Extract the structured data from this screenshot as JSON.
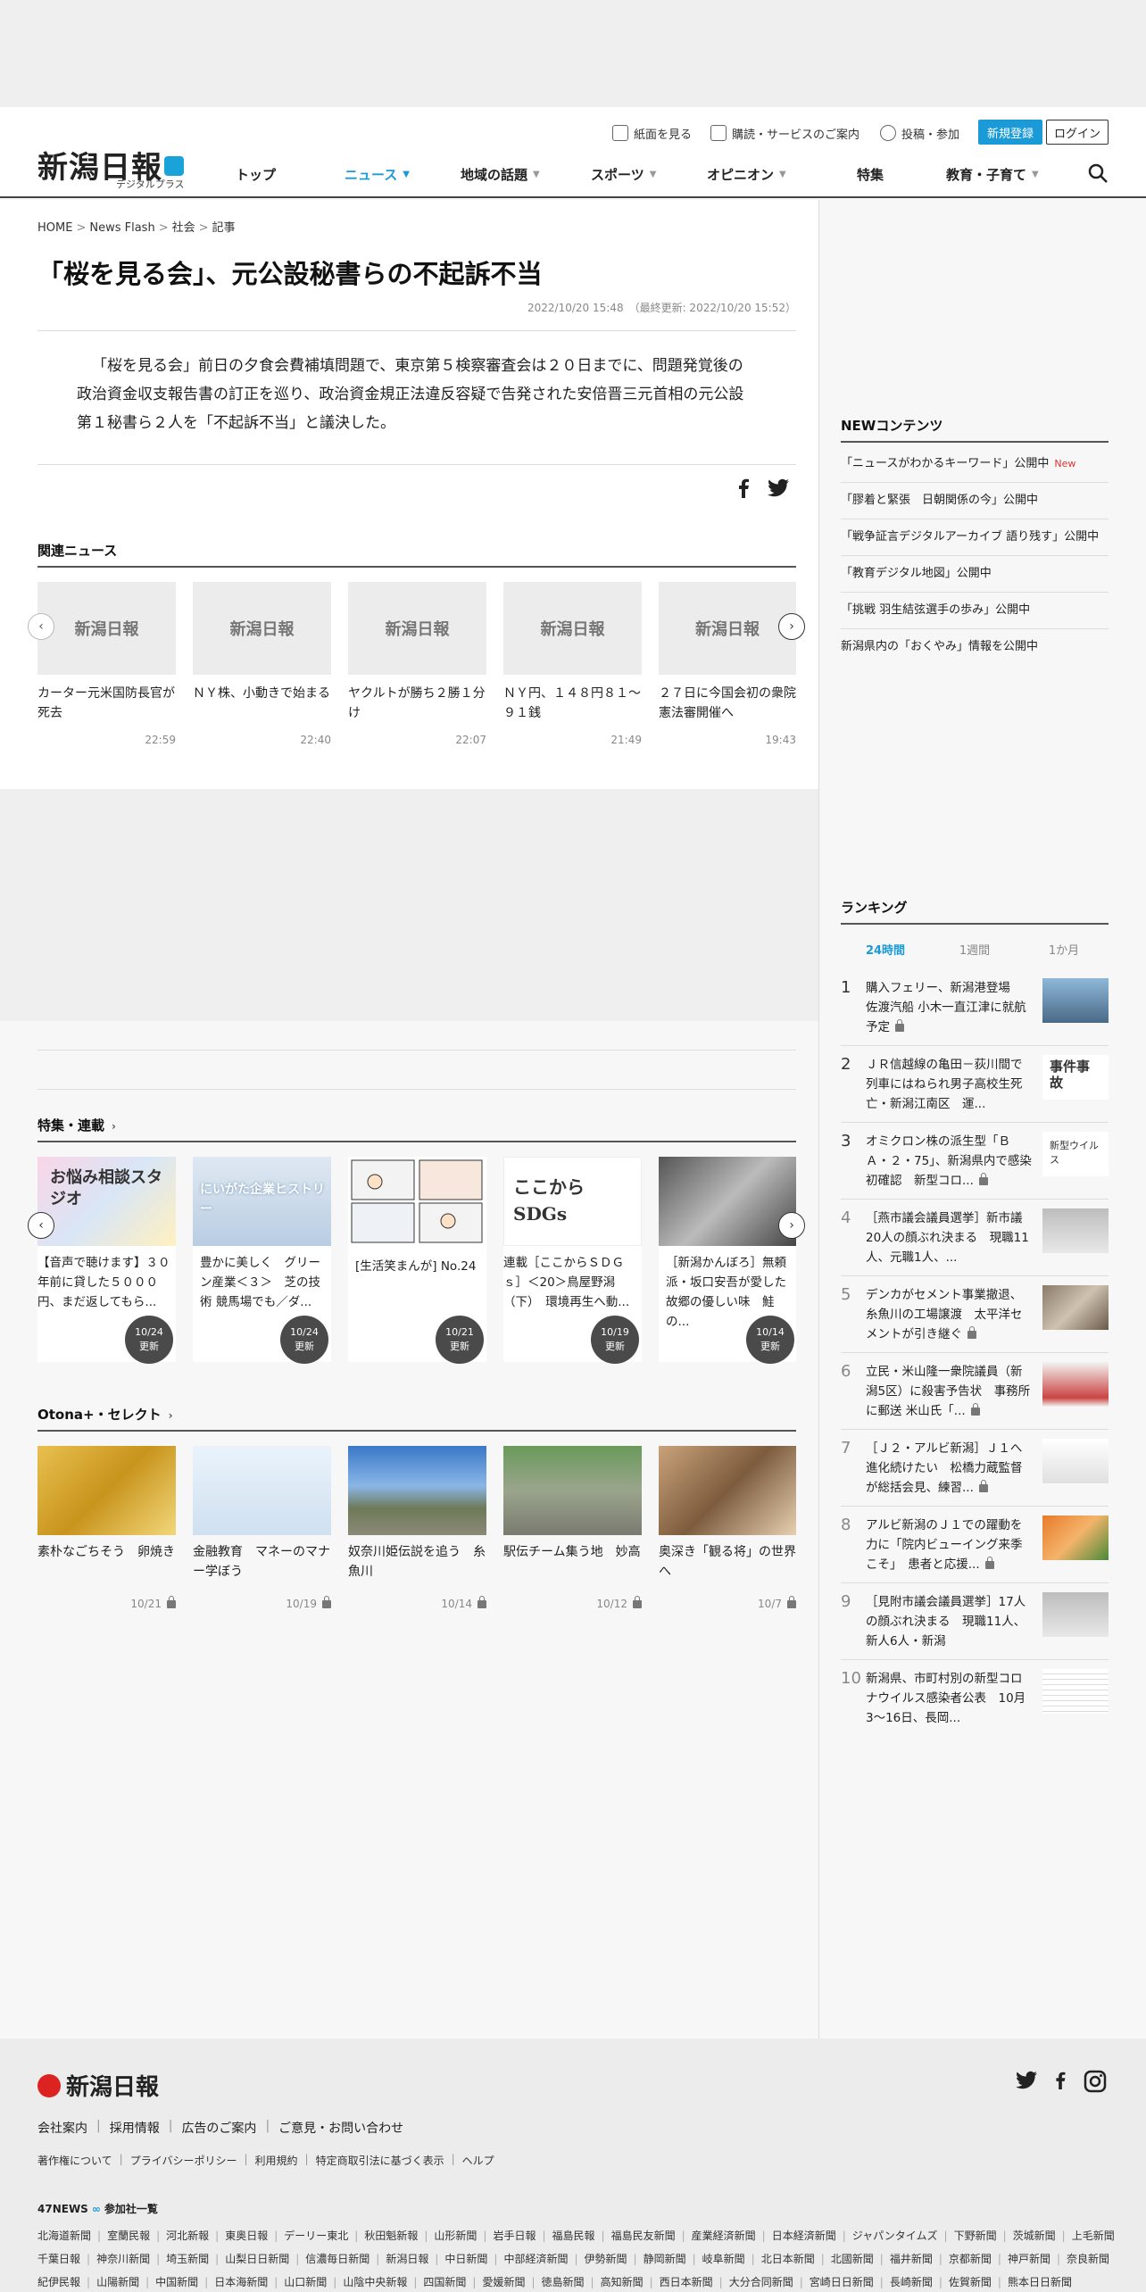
{
  "header": {
    "logo_text": "新潟日報",
    "logo_sub": "デジタルプラス",
    "util_links": [
      "紙面を見る",
      "購読・サービスのご案内",
      "投稿・参加"
    ],
    "register_label": "新規登録",
    "login_label": "ログイン",
    "nav": [
      {
        "label": "トップ",
        "caret": false,
        "active": false
      },
      {
        "label": "ニュース",
        "caret": true,
        "active": true
      },
      {
        "label": "地域の話題",
        "caret": true,
        "active": false
      },
      {
        "label": "スポーツ",
        "caret": true,
        "active": false
      },
      {
        "label": "オピニオン",
        "caret": true,
        "active": false
      },
      {
        "label": "特集",
        "caret": false,
        "active": false
      },
      {
        "label": "教育・子育て",
        "caret": true,
        "active": false
      }
    ],
    "accent_color": "#1a9ad6"
  },
  "article": {
    "breadcrumb": [
      "HOME",
      "News Flash",
      "社会",
      "記事"
    ],
    "title": "「桜を見る会」、元公設秘書らの不起訴不当",
    "date": "2022/10/20 15:48　（最終更新: 2022/10/20 15:52）",
    "body": "「桜を見る会」前日の夕食会費補填問題で、東京第５検察審査会は２０日までに、問題発覚後の政治資金収支報告書の訂正を巡り、政治資金規正法違反容疑で告発された安倍晋三元首相の元公設第１秘書ら２人を「不起訴不当」と議決した。"
  },
  "related": {
    "heading": "関連ニュース",
    "placeholder_logo": "新潟日報",
    "items": [
      {
        "title": "カーター元米国防長官が死去",
        "time": "22:59"
      },
      {
        "title": "ＮＹ株、小動きで始まる",
        "time": "22:40"
      },
      {
        "title": "ヤクルトが勝ち２勝１分け",
        "time": "22:07"
      },
      {
        "title": "ＮＹ円、１４８円８１～９１銭",
        "time": "21:49"
      },
      {
        "title": "２７日に今国会初の衆院憲法審開催へ",
        "time": "19:43"
      }
    ]
  },
  "features": {
    "heading": "特集・連載",
    "update_label": "更新",
    "items": [
      {
        "title": "【音声で聴けます】３０年前に貸した５０００円、まだ返してもら...",
        "date": "10/24",
        "image": "お悩み相談スタジオ"
      },
      {
        "title": "豊かに美しく　グリーン産業＜３＞　芝の技術 競馬場でも／ダ...",
        "date": "10/24",
        "image": "にいがた企業ヒストリー"
      },
      {
        "title": "[生活笑まんが] No.24",
        "date": "10/21",
        "image": "comic"
      },
      {
        "title": "連載［ここからＳＤＧｓ］＜20＞鳥屋野潟（下）　環境再生へ動...",
        "date": "10/19",
        "image": "ここからSDGs"
      },
      {
        "title": "［新潟かんぼろ］無頼派・坂口安吾が愛した故郷の優しい味　鮭の...",
        "date": "10/14",
        "image": "photo"
      }
    ]
  },
  "otona": {
    "heading": "Otona+・セレクト",
    "items": [
      {
        "title": "素朴なごちそう　卵焼き",
        "date": "10/21"
      },
      {
        "title": "金融教育　マネーのマナー学ぼう",
        "date": "10/19"
      },
      {
        "title": "奴奈川姫伝説を追う　糸魚川",
        "date": "10/14"
      },
      {
        "title": "駅伝チーム集う地　妙高",
        "date": "10/12"
      },
      {
        "title": "奥深き「観る将」の世界へ",
        "date": "10/7"
      }
    ]
  },
  "sidebar": {
    "new_heading": "NEWコンテンツ",
    "new_label": "New",
    "new_items": [
      {
        "text": "「ニュースがわかるキーワード」公開中",
        "is_new": true
      },
      {
        "text": "「膠着と緊張　日朝関係の今」公開中",
        "is_new": false
      },
      {
        "text": "「戦争証言デジタルアーカイブ 語り残す」公開中",
        "is_new": false
      },
      {
        "text": "「教育デジタル地図」公開中",
        "is_new": false
      },
      {
        "text": "「挑戦 羽生結弦選手の歩み」公開中",
        "is_new": false
      },
      {
        "text": "新潟県内の「おくやみ」情報を公開中",
        "is_new": false
      }
    ],
    "ranking_heading": "ランキング",
    "ranking_tabs": [
      "24時間",
      "1週間",
      "1か月"
    ],
    "ranking": [
      {
        "num": "1",
        "text": "購入フェリー、新潟港登場　佐渡汽船 小木一直江津に就航予定",
        "lock": true
      },
      {
        "num": "2",
        "text": "ＪＲ信越線の亀田－荻川間で列車にはねられ男子高校生死亡・新潟江南区　運...",
        "lock": false,
        "img_text": "事件事故"
      },
      {
        "num": "3",
        "text": "オミクロン株の派生型「ＢＡ・２・75」、新潟県内で感染初確認　新型コロ...",
        "lock": true,
        "img_text": "新型ウイルス"
      },
      {
        "num": "4",
        "text": "［燕市議会議員選挙］新市議20人の顔ぶれ決まる　現職11人、元職1人、...",
        "lock": false
      },
      {
        "num": "5",
        "text": "デンカがセメント事業撤退、糸魚川の工場譲渡　太平洋セメントが引き継ぐ",
        "lock": true
      },
      {
        "num": "6",
        "text": "立民・米山隆一衆院議員（新潟5区）に殺害予告状　事務所に郵送 米山氏「...",
        "lock": true
      },
      {
        "num": "7",
        "text": "［Ｊ２・アルビ新潟］Ｊ１へ進化続けたい　松橋力蔵監督が総括会見、練習...",
        "lock": true
      },
      {
        "num": "8",
        "text": "アルビ新潟のＪ１での躍動を力に「院内ビューイング来季こそ」　患者と応援...",
        "lock": true
      },
      {
        "num": "9",
        "text": "［見附市議会議員選挙］17人の顔ぶれ決まる　現職11人、新人6人・新潟",
        "lock": false
      },
      {
        "num": "10",
        "text": "新潟県、市町村別の新型コロナウイルス感染者公表　10月3〜16日、長岡...",
        "lock": false
      }
    ]
  },
  "footer": {
    "logo_text": "新潟日報",
    "links": [
      "会社案内",
      "採用情報",
      "広告のご案内",
      "ご意見・お問い合わせ"
    ],
    "small_links": [
      "著作権について",
      "プライバシーポリシー",
      "利用規約",
      "特定商取引法に基づく表示",
      "ヘルプ"
    ],
    "news47": "47NEWS",
    "news47_label": "参加社一覧",
    "papers_row1": [
      "北海道新聞",
      "室蘭民報",
      "河北新報",
      "東奥日報",
      "デーリー東北",
      "秋田魁新報",
      "山形新聞",
      "岩手日報",
      "福島民報",
      "福島民友新聞",
      "産業経済新聞",
      "日本経済新聞",
      "ジャパンタイムズ",
      "下野新聞",
      "茨城新聞",
      "上毛新聞"
    ],
    "papers_row2": [
      "千葉日報",
      "神奈川新聞",
      "埼玉新聞",
      "山梨日日新聞",
      "信濃毎日新聞",
      "新潟日報",
      "中日新聞",
      "中部経済新聞",
      "伊勢新聞",
      "静岡新聞",
      "岐阜新聞",
      "北日本新聞",
      "北國新聞",
      "福井新聞",
      "京都新聞",
      "神戸新聞",
      "奈良新聞"
    ],
    "papers_row3": [
      "紀伊民報",
      "山陽新聞",
      "中国新聞",
      "日本海新聞",
      "山口新聞",
      "山陰中央新報",
      "四国新聞",
      "愛媛新聞",
      "徳島新聞",
      "高知新聞",
      "西日本新聞",
      "大分合同新聞",
      "宮崎日日新聞",
      "長崎新聞",
      "佐賀新聞",
      "熊本日日新聞"
    ]
  }
}
